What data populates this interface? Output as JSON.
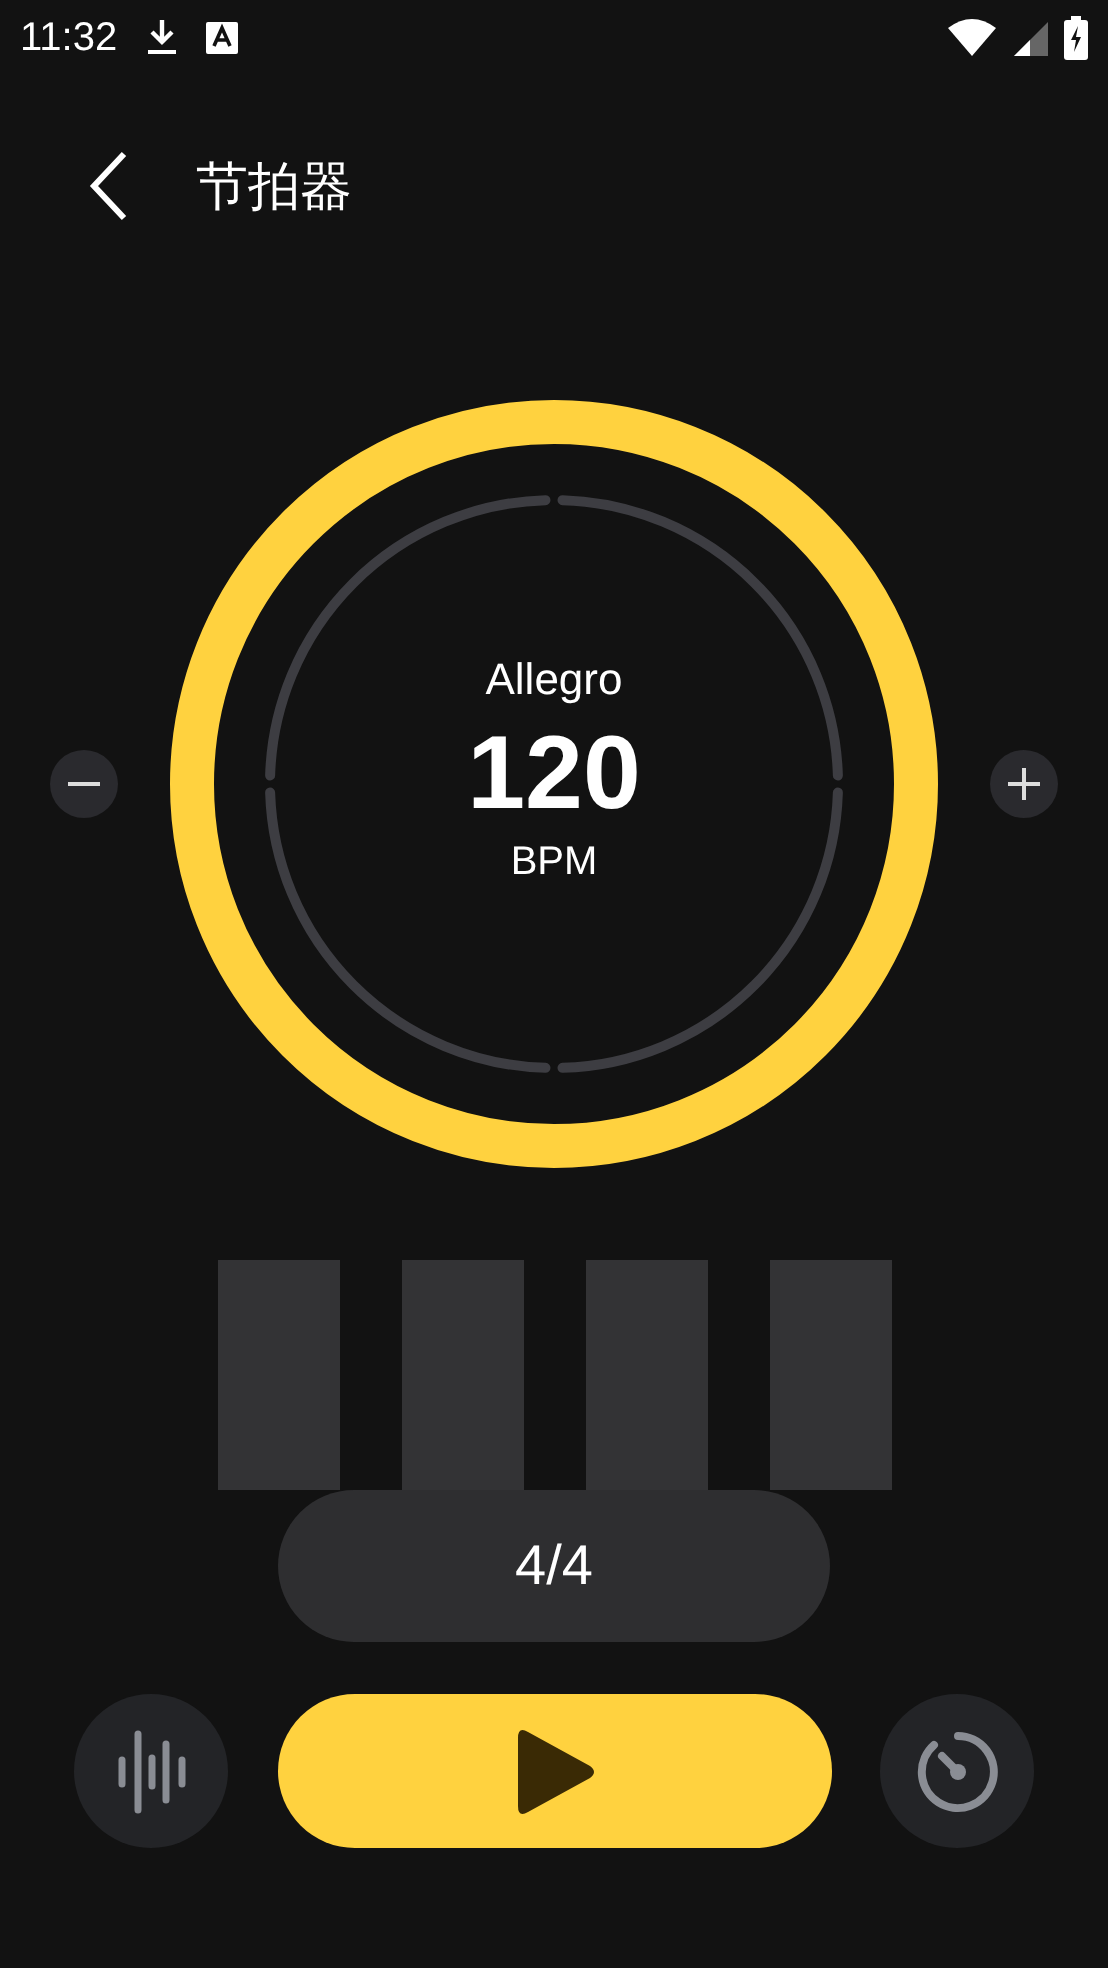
{
  "status_bar": {
    "time": "11:32"
  },
  "header": {
    "title": "节拍器"
  },
  "tempo": {
    "marking": "Allegro",
    "bpm": "120",
    "unit": "BPM"
  },
  "beats": [
    {
      "active": false
    },
    {
      "active": false
    },
    {
      "active": false
    },
    {
      "active": false
    }
  ],
  "time_signature": "4/4",
  "player": {
    "playing": false
  }
}
